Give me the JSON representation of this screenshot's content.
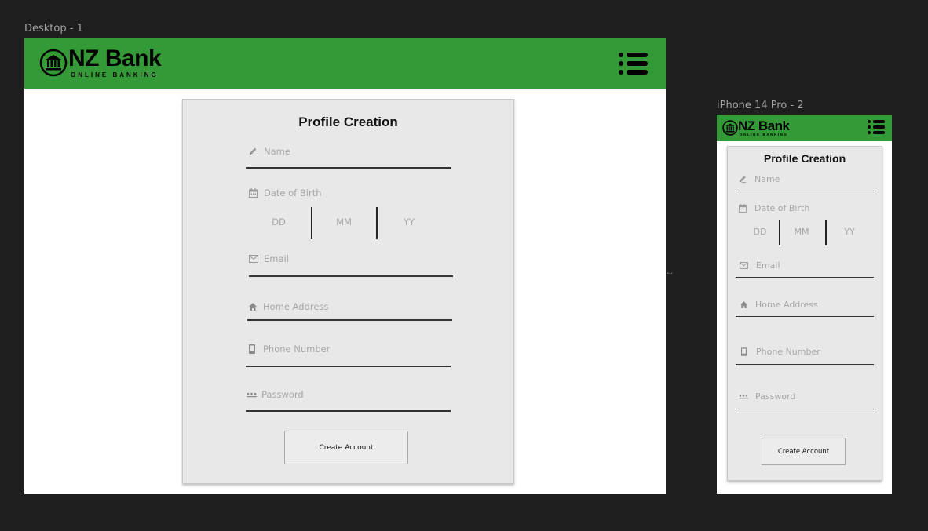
{
  "canvas": {
    "desktop_frame_label": "Desktop - 1",
    "mobile_frame_label": "iPhone 14 Pro - 2",
    "more_indicator": "..."
  },
  "brand": {
    "title": "NZ Bank",
    "subtitle": "ONLINE BANKING",
    "header_color": "#349a37"
  },
  "form": {
    "title": "Profile Creation",
    "name_placeholder": "Name",
    "dob_label": "Date of Birth",
    "dob_day": "DD",
    "dob_month": "MM",
    "dob_year": "YY",
    "email_placeholder": "Email",
    "address_placeholder": "Home Address",
    "phone_placeholder": "Phone Number",
    "password_placeholder": "Password",
    "submit_label": "Create Account"
  },
  "icons": {
    "logo": "bank-building-icon",
    "menu": "hamburger-menu-icon",
    "name": "pencil-icon",
    "dob": "calendar-icon",
    "email": "mail-icon",
    "address": "home-icon",
    "phone": "phone-icon",
    "password": "password-icon"
  }
}
